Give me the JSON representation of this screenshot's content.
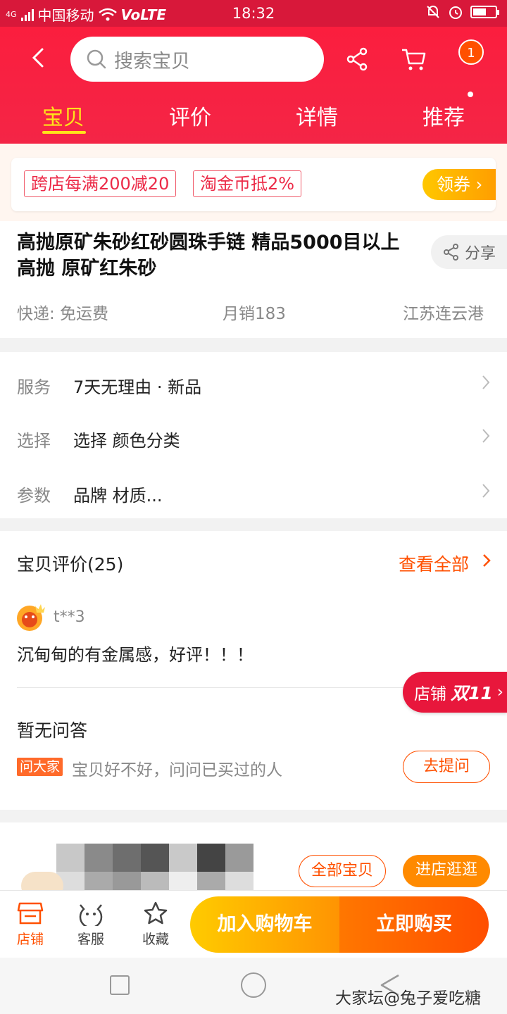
{
  "status_bar": {
    "net_type": "4G",
    "carrier": "中国移动",
    "volte": "VoLTE",
    "time": "18:32"
  },
  "header": {
    "search_placeholder": "搜索宝贝",
    "cart_badge": "1",
    "tabs": [
      {
        "label": "宝贝",
        "active": true
      },
      {
        "label": "评价",
        "active": false
      },
      {
        "label": "详情",
        "active": false
      },
      {
        "label": "推荐",
        "active": false
      }
    ]
  },
  "coupons": {
    "tags": [
      "跨店每满200减20",
      "淘金币抵2%"
    ],
    "get_label": "领券"
  },
  "product": {
    "title": "高抛原矿朱砂红砂圆珠手链 精品5000目以上高抛 原矿红朱砂",
    "share_label": "分享",
    "shipping": "快递: 免运费",
    "monthly_sales": "月销183",
    "location": "江苏连云港"
  },
  "service": {
    "rows": [
      {
        "label": "服务",
        "value": "7天无理由 · 新品"
      },
      {
        "label": "选择",
        "value": "选择 颜色分类"
      },
      {
        "label": "参数",
        "value": "品牌 材质..."
      }
    ]
  },
  "reviews": {
    "title": "宝贝评价(25)",
    "see_all": "查看全部",
    "reviewer": "t**3",
    "text": "沉甸甸的有金属感，好评！！！"
  },
  "qa": {
    "title": "暂无问答",
    "ask_tag": "问大家",
    "hint": "宝贝好不好，问问已买过的人",
    "ask_button": "去提问"
  },
  "promo": {
    "label": "店铺",
    "d11": "双11"
  },
  "shop": {
    "all_items": "全部宝贝",
    "enter_shop": "进店逛逛"
  },
  "bottom_bar": {
    "store": "店铺",
    "service": "客服",
    "favorite": "收藏",
    "add_to_cart": "加入购物车",
    "buy_now": "立即购买"
  },
  "watermark": "大家坛@兔子爱吃糖",
  "colors": {
    "brand_red": "#fb1e3e",
    "accent_orange": "#ff5000",
    "tab_active": "#ffe31a"
  }
}
